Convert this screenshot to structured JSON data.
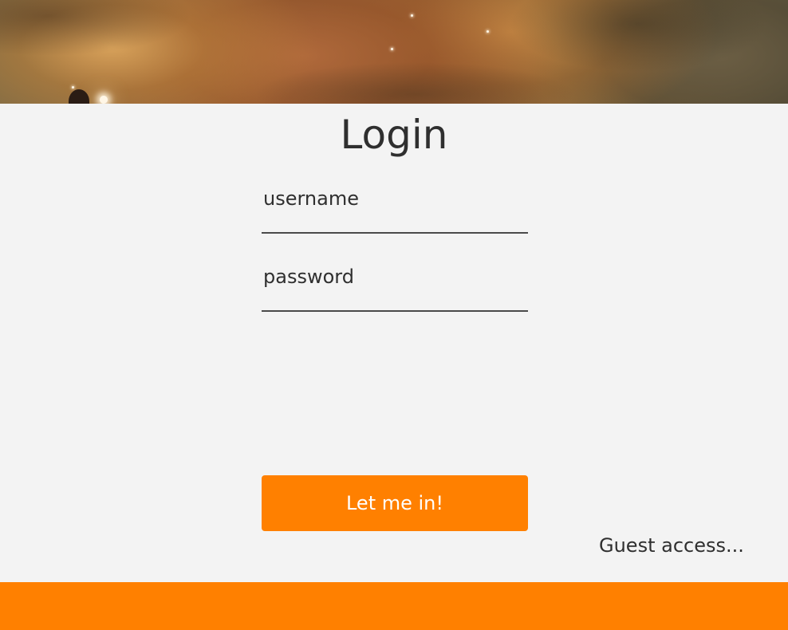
{
  "header": {
    "image": "nebula-banner"
  },
  "login": {
    "title": "Login",
    "username_label": "username",
    "username_value": "",
    "password_label": "password",
    "password_value": "",
    "submit_label": "Let me in!",
    "guest_link": "Guest access..."
  },
  "colors": {
    "accent": "#ff8000",
    "background": "#f3f3f3",
    "text": "#2f2f2f",
    "underline": "#4a4a4a"
  }
}
